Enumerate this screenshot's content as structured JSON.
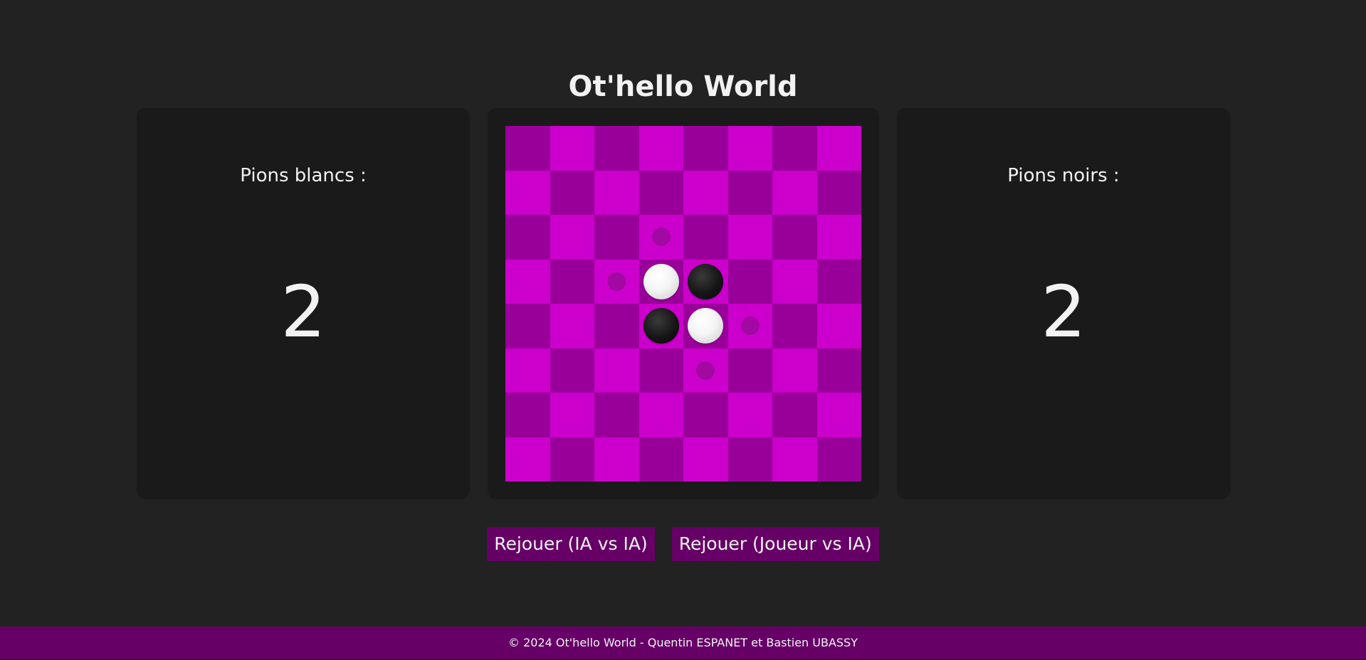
{
  "header": {
    "title": "Ot'hello World"
  },
  "scores": {
    "white_label": "Pions blancs :",
    "white_count": "2",
    "black_label": "Pions noirs :",
    "black_count": "2"
  },
  "board": {
    "size": 8,
    "colors": {
      "dark": "#990099",
      "light": "#cc00cc",
      "hint": "#9a0b9a"
    },
    "cells": [
      [
        "",
        "",
        "",
        "",
        "",
        "",
        "",
        ""
      ],
      [
        "",
        "",
        "",
        "",
        "",
        "",
        "",
        ""
      ],
      [
        "",
        "",
        "",
        "hint",
        "",
        "",
        "",
        ""
      ],
      [
        "",
        "",
        "hint",
        "white",
        "black",
        "",
        "",
        ""
      ],
      [
        "",
        "",
        "",
        "black",
        "white",
        "hint",
        "",
        ""
      ],
      [
        "",
        "",
        "",
        "",
        "hint",
        "",
        "",
        ""
      ],
      [
        "",
        "",
        "",
        "",
        "",
        "",
        "",
        ""
      ],
      [
        "",
        "",
        "",
        "",
        "",
        "",
        "",
        ""
      ]
    ]
  },
  "actions": {
    "replay_ai_vs_ai": "Rejouer (IA vs IA)",
    "replay_player_vs_ai": "Rejouer (Joueur vs IA)"
  },
  "footer": {
    "text": "© 2024 Ot'hello World - Quentin ESPANET et Bastien UBASSY"
  },
  "theme": {
    "background": "#222222",
    "panel": "#1a1a1a",
    "accent": "#660066"
  }
}
